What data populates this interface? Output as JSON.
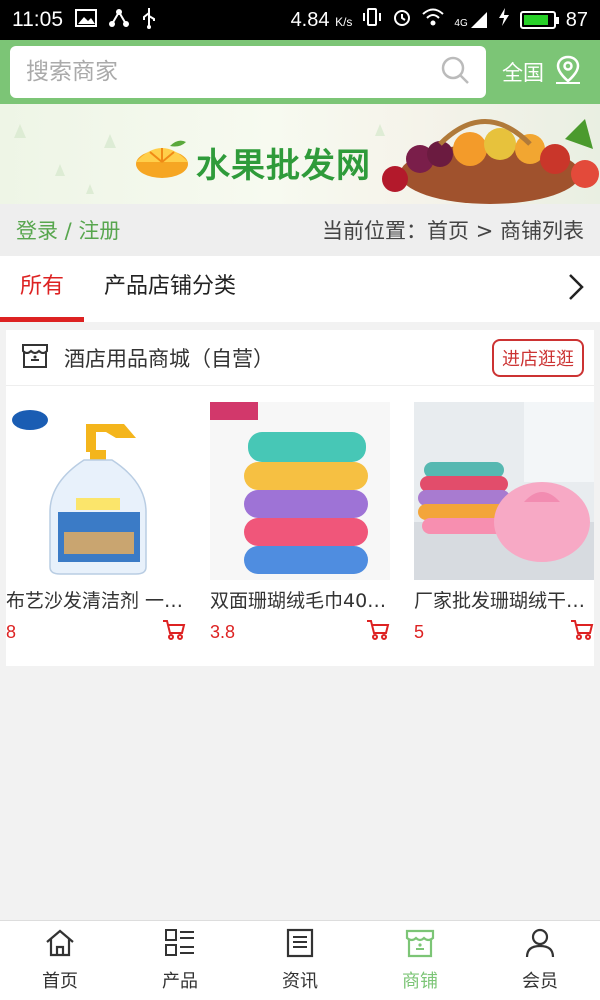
{
  "status_bar": {
    "time": "11:05",
    "speed": "4.84",
    "speed_unit": "K/s",
    "network": "4G",
    "battery": "87",
    "battery_level": 0.87
  },
  "search": {
    "placeholder": "搜索商家",
    "region_label": "全国"
  },
  "banner": {
    "title": "水果批发网"
  },
  "breadcrumb": {
    "login": "登录 / 注册",
    "location": "当前位置：首页 > 商铺列表"
  },
  "tabs": [
    {
      "label": "所有",
      "active": true
    },
    {
      "label": "产品店铺分类",
      "active": false
    }
  ],
  "shop": {
    "name": "酒店用品商城（自营）",
    "enter_label": "进店逛逛",
    "products": [
      {
        "name": "布艺沙发清洁剂 一…",
        "price": "8",
        "image": "cleaner-bottle"
      },
      {
        "name": "双面珊瑚绒毛巾40…",
        "price": "3.8",
        "image": "towel-stack"
      },
      {
        "name": "厂家批发珊瑚绒干…",
        "price": "5",
        "image": "hair-cap"
      }
    ]
  },
  "bottom_nav": [
    {
      "label": "首页",
      "icon": "home-icon",
      "active": false
    },
    {
      "label": "产品",
      "icon": "grid-list-icon",
      "active": false
    },
    {
      "label": "资讯",
      "icon": "news-icon",
      "active": false
    },
    {
      "label": "商铺",
      "icon": "store-icon",
      "active": true
    },
    {
      "label": "会员",
      "icon": "user-icon",
      "active": false
    }
  ],
  "colors": {
    "brand_green": "#7cc576",
    "accent_red": "#dd2222"
  }
}
